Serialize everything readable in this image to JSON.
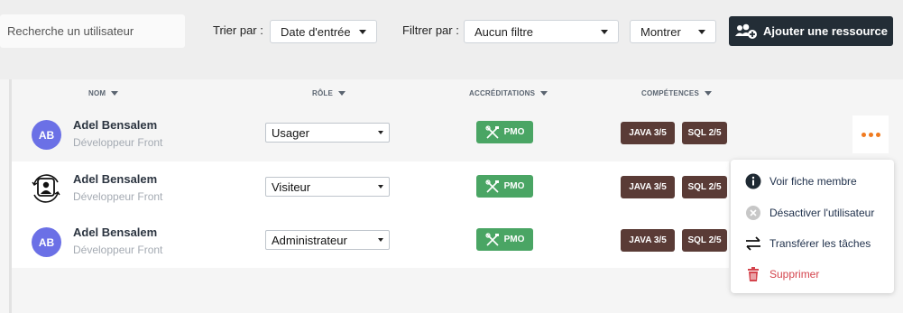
{
  "toolbar": {
    "search_placeholder": "Recherche un utilisateur",
    "sort_label": "Trier par :",
    "sort_value": "Date d'entrée",
    "filter_label": "Filtrer par :",
    "filter_value": "Aucun filtre",
    "show_value": "Montrer",
    "add_button": "Ajouter une ressource"
  },
  "columns": {
    "name": "NOM",
    "role": "RÔLE",
    "accreditations": "ACCRÉDITATIONS",
    "skills": "COMPÉTENCES"
  },
  "rows": [
    {
      "initials": "AB",
      "name": "Adel Bensalem",
      "title": "Développeur Front",
      "role": "Usager",
      "accreditation": "PMO",
      "skills": [
        "JAVA 3/5",
        "SQL 2/5"
      ]
    },
    {
      "initials": "",
      "name": "Adel Bensalem",
      "title": "Développeur Front",
      "role": "Visiteur",
      "accreditation": "PMO",
      "skills": [
        "JAVA 3/5",
        "SQL 2/5"
      ]
    },
    {
      "initials": "AB",
      "name": "Adel Bensalem",
      "title": "Développeur Front",
      "role": "Administrateur",
      "accreditation": "PMO",
      "skills": [
        "JAVA 3/5",
        "SQL 2/5"
      ]
    }
  ],
  "menu": {
    "view": "Voir fiche membre",
    "deactivate": "Désactiver l'utilisateur",
    "transfer": "Transférer les tâches",
    "delete": "Supprimer"
  },
  "colors": {
    "accent_orange": "#f07a1f",
    "avatar": "#6b70e6",
    "accreditation_green": "#4aa564",
    "skill_brown": "#5a3b36",
    "danger": "#d4444d",
    "button_dark": "#232d36"
  }
}
